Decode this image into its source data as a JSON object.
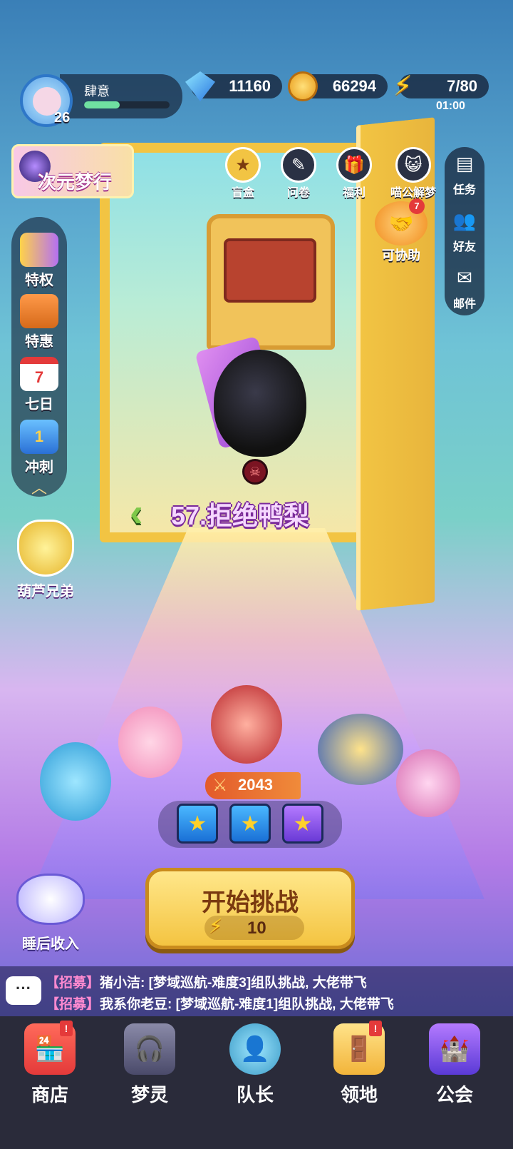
{
  "player": {
    "name": "肆意",
    "level": "26",
    "xp_fraction": 0.42
  },
  "resources": {
    "gems": "11160",
    "coins": "66294",
    "energy": "7/80",
    "energy_timer": "01:00"
  },
  "event_banner": {
    "label": "次元梦行"
  },
  "left_menu": [
    {
      "label": "特权",
      "icon": "privilege-card-icon"
    },
    {
      "label": "特惠",
      "icon": "gift-box-icon"
    },
    {
      "label": "七日",
      "icon": "calendar-icon",
      "icon_text": "7"
    },
    {
      "label": "冲刺",
      "icon": "sprint-medal-icon",
      "icon_text": "1"
    }
  ],
  "gourd": {
    "label": "葫芦兄弟"
  },
  "top_menu": [
    {
      "label": "盲盒",
      "icon": "blind-box-icon"
    },
    {
      "label": "问卷",
      "icon": "survey-icon"
    },
    {
      "label": "福利",
      "icon": "welfare-gift-icon"
    },
    {
      "label": "喵公解梦",
      "icon": "cat-dream-icon"
    }
  ],
  "right_menu": [
    {
      "label": "任务",
      "icon": "task-icon"
    },
    {
      "label": "好友",
      "icon": "friends-icon"
    },
    {
      "label": "邮件",
      "icon": "mail-icon"
    }
  ],
  "assist": {
    "label": "可协助",
    "badge": "7"
  },
  "stage": {
    "title": "57.拒绝鸭梨"
  },
  "team": {
    "power": "2043"
  },
  "start_button": {
    "label": "开始挑战",
    "cost": "10"
  },
  "sleep_income": {
    "label": "睡后收入"
  },
  "chat": {
    "button_label": "···",
    "lines": [
      {
        "tag": "【招募】",
        "text": "猪小洁: [梦域巡航-难度3]组队挑战, 大佬带飞"
      },
      {
        "tag": "【招募】",
        "text": "我系你老豆: [梦域巡航-难度1]组队挑战, 大佬带飞"
      }
    ]
  },
  "bottom_nav": [
    {
      "label": "商店",
      "icon": "shop-icon",
      "badge": "!"
    },
    {
      "label": "梦灵",
      "icon": "dream-spirit-icon"
    },
    {
      "label": "队长",
      "icon": "captain-icon"
    },
    {
      "label": "领地",
      "icon": "territory-door-icon",
      "badge": "!"
    },
    {
      "label": "公会",
      "icon": "guild-icon"
    }
  ]
}
